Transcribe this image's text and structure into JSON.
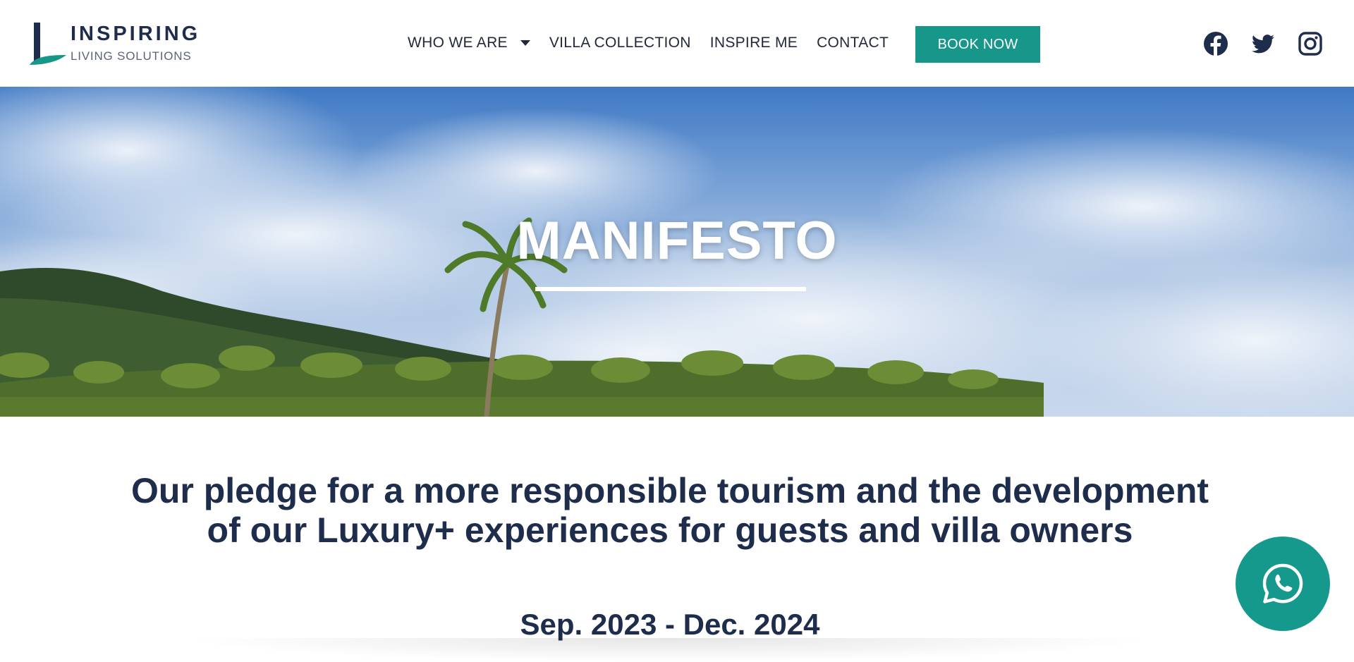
{
  "brand": {
    "name_line1": "INSPIRING",
    "name_line2": "LIVING SOLUTIONS",
    "logo_icon": "l-leaf-logo"
  },
  "nav": {
    "items": [
      {
        "label": "WHO WE ARE",
        "has_dropdown": true
      },
      {
        "label": "VILLA COLLECTION"
      },
      {
        "label": "INSPIRE ME"
      },
      {
        "label": "CONTACT"
      }
    ],
    "book_label": "BOOK NOW"
  },
  "social": {
    "icons": [
      "facebook-icon",
      "twitter-icon",
      "instagram-icon"
    ]
  },
  "hero": {
    "title": "MANIFESTO",
    "image": "tropical-palm-trees-under-cloudy-sky"
  },
  "content": {
    "pledge_text": "Our pledge for a more responsible tourism and the development of our Luxury+ experiences for guests and villa owners",
    "dates": "Sep. 2023 - Dec. 2024"
  },
  "floating": {
    "whatsapp_icon": "whatsapp-icon"
  },
  "colors": {
    "brand_navy": "#1f2d4d",
    "accent_teal": "#17968a",
    "whatsapp_teal": "#15998c"
  }
}
